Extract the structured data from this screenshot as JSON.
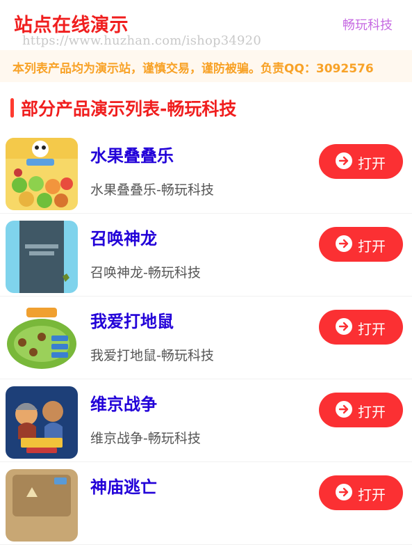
{
  "header": {
    "title": "站点在线演示",
    "brand": "畅玩科技",
    "watermark": "https://www.huzhan.com/ishop34920"
  },
  "notice": {
    "text": "本列表产品均为演示站，谨慎交易，谨防被骗。负责QQ：3092576"
  },
  "section": {
    "title": "部分产品演示列表-畅玩科技"
  },
  "open_label": "打开",
  "items": [
    {
      "title": "水果叠叠乐",
      "subtitle": "水果叠叠乐-畅玩科技",
      "thumb": "fruit-game"
    },
    {
      "title": "召唤神龙",
      "subtitle": "召唤神龙-畅玩科技",
      "thumb": "dragon-game"
    },
    {
      "title": "我爱打地鼠",
      "subtitle": "我爱打地鼠-畅玩科技",
      "thumb": "whack-mole-game"
    },
    {
      "title": "维京战争",
      "subtitle": "维京战争-畅玩科技",
      "thumb": "viking-game"
    },
    {
      "title": "神庙逃亡",
      "subtitle": "",
      "thumb": "temple-game"
    }
  ],
  "colors": {
    "accent": "#f01e1e",
    "brand": "#c66ae2",
    "notice": "#f8a227",
    "link": "#2200d8",
    "button": "#fb3033"
  }
}
